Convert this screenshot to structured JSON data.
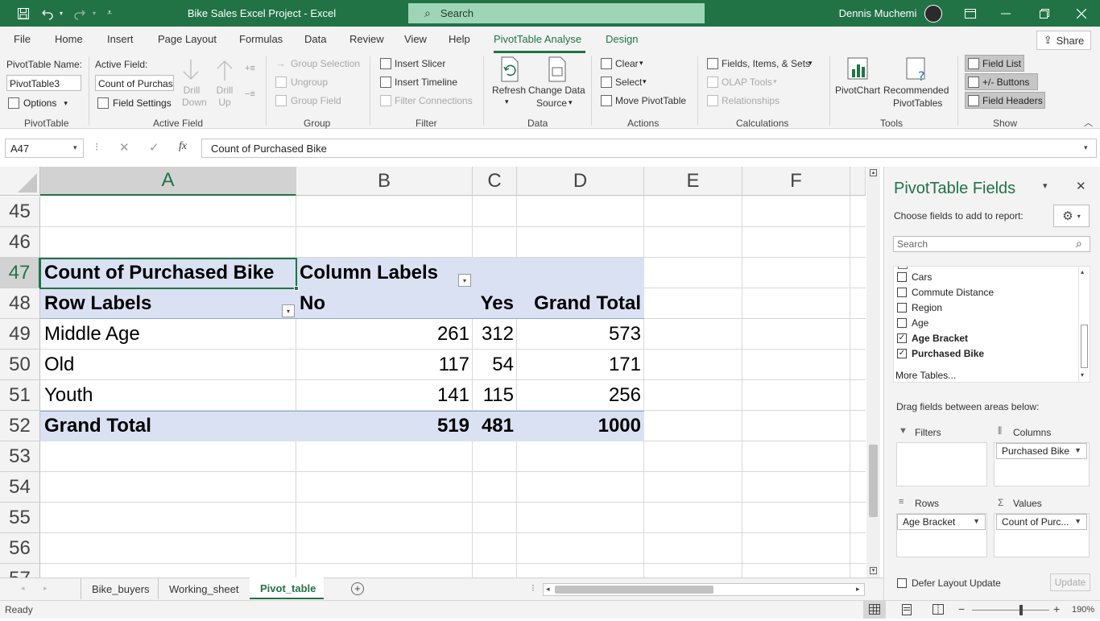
{
  "titlebar": {
    "title": "Bike Sales Excel Project  -  Excel",
    "search_placeholder": "Search",
    "user": "Dennis Muchemi"
  },
  "tabs": [
    "File",
    "Home",
    "Insert",
    "Page Layout",
    "Formulas",
    "Data",
    "Review",
    "View",
    "Help",
    "PivotTable Analyse",
    "Design"
  ],
  "share_label": "Share",
  "ribbon": {
    "pivottable_name_label": "PivotTable Name:",
    "pivottable_name_value": "PivotTable3",
    "options_label": "Options",
    "active_field_label": "Active Field:",
    "active_field_value": "Count of Purchase",
    "field_settings_label": "Field Settings",
    "drill_down": "Drill Down",
    "drill_up": "Drill Up",
    "group_selection": "Group Selection",
    "ungroup": "Ungroup",
    "group_field": "Group Field",
    "insert_slicer": "Insert Slicer",
    "insert_timeline": "Insert Timeline",
    "filter_connections": "Filter Connections",
    "refresh": "Refresh",
    "change_data_source_1": "Change Data",
    "change_data_source_2": "Source",
    "clear": "Clear",
    "select": "Select",
    "move_pivottable": "Move PivotTable",
    "fields_items_sets": "Fields, Items, & Sets",
    "olap_tools": "OLAP Tools",
    "relationships": "Relationships",
    "pivotchart": "PivotChart",
    "recommended_1": "Recommended",
    "recommended_2": "PivotTables",
    "field_list": "Field List",
    "plus_minus_buttons": "+/- Buttons",
    "field_headers": "Field Headers",
    "groups": {
      "pivottable": "PivotTable",
      "active_field": "Active Field",
      "group": "Group",
      "filter": "Filter",
      "data": "Data",
      "actions": "Actions",
      "calculations": "Calculations",
      "tools": "Tools",
      "show": "Show"
    }
  },
  "formula_bar": {
    "name_box": "A47",
    "formula": "Count of Purchased Bike"
  },
  "sheet": {
    "columns": [
      "A",
      "B",
      "C",
      "D",
      "E",
      "F"
    ],
    "rows": [
      "45",
      "46",
      "47",
      "48",
      "49",
      "50",
      "51",
      "52",
      "53",
      "54",
      "55",
      "56",
      "57"
    ],
    "pivot": {
      "value_field": "Count of Purchased Bike",
      "column_labels": "Column Labels",
      "row_labels": "Row Labels",
      "headers": [
        "No",
        "Yes",
        "Grand Total"
      ],
      "data_rows": [
        {
          "label": "Middle Age",
          "no": "261",
          "yes": "312",
          "total": "573"
        },
        {
          "label": "Old",
          "no": "117",
          "yes": "54",
          "total": "171"
        },
        {
          "label": "Youth",
          "no": "141",
          "yes": "115",
          "total": "256"
        }
      ],
      "grand_total": {
        "label": "Grand Total",
        "no": "519",
        "yes": "481",
        "total": "1000"
      }
    }
  },
  "sheet_tabs": [
    "Bike_buyers",
    "Working_sheet",
    "Pivot_table"
  ],
  "active_sheet": "Pivot_table",
  "pane": {
    "title": "PivotTable Fields",
    "subtitle": "Choose fields to add to report:",
    "search_placeholder": "Search",
    "fields": [
      {
        "name": "Cars",
        "checked": false
      },
      {
        "name": "Commute Distance",
        "checked": false
      },
      {
        "name": "Region",
        "checked": false
      },
      {
        "name": "Age",
        "checked": false
      },
      {
        "name": "Age Bracket",
        "checked": true
      },
      {
        "name": "Purchased Bike",
        "checked": true
      }
    ],
    "more_tables": "More Tables...",
    "drag_label": "Drag fields between areas below:",
    "filters_label": "Filters",
    "columns_label": "Columns",
    "rows_label": "Rows",
    "values_label": "Values",
    "columns_item": "Purchased Bike",
    "rows_item": "Age Bracket",
    "values_item": "Count of Purc...",
    "defer_label": "Defer Layout Update",
    "update_label": "Update"
  },
  "status": {
    "ready": "Ready",
    "zoom": "190%"
  },
  "colors": {
    "excel_green": "#217346",
    "pivot_band": "#d9e1f2",
    "active_tab": "#217346"
  }
}
